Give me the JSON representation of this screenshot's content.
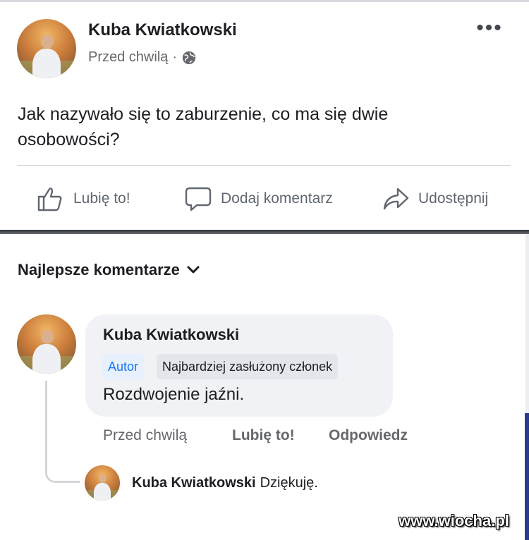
{
  "post": {
    "author": "Kuba Kwiatkowski",
    "time": "Przed chwilą",
    "meta_sep": "·",
    "privacy_icon": "globe-icon",
    "more_icon": "more-options-icon",
    "more_glyph": "•••",
    "text": "Jak nazywało się to zaburzenie, co ma się dwie osobowości?",
    "actions": {
      "like": "Lubię to!",
      "comment": "Dodaj komentarz",
      "share": "Udostępnij"
    }
  },
  "comments": {
    "heading": "Najlepsze komentarze",
    "top_comment": {
      "author": "Kuba Kwiatkowski",
      "badges": [
        "Autor",
        "Najbardziej zasłużony członek"
      ],
      "text": "Rozdwojenie jaźni.",
      "time": "Przed chwilą",
      "like": "Lubię to!",
      "reply": "Odpowiedz"
    },
    "reply": {
      "author": "Kuba Kwiatkowski",
      "text": "Dziękuję."
    }
  },
  "watermark": "www.wiocha.pl",
  "colors": {
    "accent": "#1877f2",
    "text": "#1c1e21",
    "secondary_text": "#65676b",
    "bubble": "#f0f2f5"
  }
}
